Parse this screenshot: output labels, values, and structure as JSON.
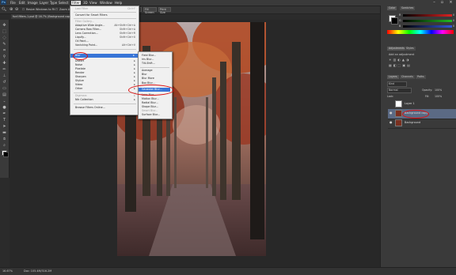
{
  "menubar": {
    "items": [
      "File",
      "Edit",
      "Image",
      "Layer",
      "Type",
      "Select",
      "Filter",
      "3D",
      "View",
      "Window",
      "Help"
    ],
    "window_controls": [
      "–",
      "▫",
      "×"
    ]
  },
  "options_bar": {
    "resize_windows": "Resize Windows to Fit",
    "zoom_all": "Zoom All Windows",
    "scrubby_zoom": "Scrubby Zoom",
    "actual_pixels": "Actual Pixels",
    "fit_screen": "Fit Screen",
    "fill_screen": "Fill Screen",
    "print_size": "Print Size"
  },
  "document_tab": "funf-filters-1.psd @ 16.7% (Background copy, RGB/8)",
  "filter_menu": {
    "items": [
      {
        "label": "Last Filter",
        "shortcut": "Ctrl+F",
        "disabled": true
      },
      {
        "sep": true
      },
      {
        "label": "Convert for Smart Filters"
      },
      {
        "sep": true
      },
      {
        "label": "Filter Gallery...",
        "disabled": true
      },
      {
        "label": "Adaptive Wide Angle...",
        "shortcut": "Alt+Shift+Ctrl+A"
      },
      {
        "label": "Camera Raw Filter...",
        "shortcut": "Shift+Ctrl+A"
      },
      {
        "label": "Lens Correction...",
        "shortcut": "Shift+Ctrl+R"
      },
      {
        "label": "Liquify...",
        "shortcut": "Shift+Ctrl+X"
      },
      {
        "label": "Oil Paint..."
      },
      {
        "label": "Vanishing Point...",
        "shortcut": "Alt+Ctrl+V"
      },
      {
        "sep": true
      },
      {
        "label": "Blur",
        "submenu": true,
        "highlighted": true
      },
      {
        "label": "Distort",
        "submenu": true
      },
      {
        "label": "Noise",
        "submenu": true
      },
      {
        "label": "Pixelate",
        "submenu": true
      },
      {
        "label": "Render",
        "submenu": true
      },
      {
        "label": "Sharpen",
        "submenu": true
      },
      {
        "label": "Stylize",
        "submenu": true
      },
      {
        "label": "Video",
        "submenu": true
      },
      {
        "label": "Other",
        "submenu": true
      },
      {
        "sep": true
      },
      {
        "label": "Digimarc",
        "submenu": true,
        "disabled": true
      },
      {
        "label": "Nik Collection",
        "submenu": true
      },
      {
        "sep": true
      },
      {
        "label": "Browse Filters Online..."
      }
    ]
  },
  "blur_submenu": {
    "items": [
      {
        "label": "Field Blur..."
      },
      {
        "label": "Iris Blur..."
      },
      {
        "label": "Tilt-Shift..."
      },
      {
        "sep": true
      },
      {
        "label": "Average"
      },
      {
        "label": "Blur"
      },
      {
        "label": "Blur More"
      },
      {
        "label": "Box Blur..."
      },
      {
        "label": "Gaussian Blur...",
        "highlighted": true
      },
      {
        "label": "Lens Blur..."
      },
      {
        "label": "Motion Blur..."
      },
      {
        "label": "Radial Blur..."
      },
      {
        "label": "Shape Blur..."
      },
      {
        "label": "Smart Blur...",
        "disabled": true
      },
      {
        "label": "Surface Blur..."
      }
    ]
  },
  "right_panel": {
    "color_tabs": [
      "Color",
      "Swatches"
    ],
    "color_sliders": [
      {
        "label": "R",
        "value": "0",
        "color": "#cc3333"
      },
      {
        "label": "G",
        "value": "0",
        "color": "#33aa33"
      },
      {
        "label": "B",
        "value": "0",
        "color": "#3355cc"
      }
    ],
    "adjust_tabs": [
      "Adjustments",
      "Styles"
    ],
    "adjust_title": "Add an adjustment",
    "layer_tabs": [
      "Layers",
      "Channels",
      "Paths"
    ],
    "kind_label": "Kind",
    "blend_mode": "Normal",
    "opacity_label": "Opacity:",
    "opacity_value": "100%",
    "lock_label": "Lock:",
    "fill_label": "Fill:",
    "fill_value": "100%",
    "layers": [
      {
        "name": "Layer 1",
        "selected": false,
        "thumb": "#ffffff"
      },
      {
        "name": "Background copy",
        "selected": true,
        "thumb": "#7a3020"
      },
      {
        "name": "Background",
        "selected": false,
        "thumb": "#7a3020"
      }
    ]
  },
  "status": {
    "zoom": "16.67%",
    "doc": "Doc: 105.4M/316.2M"
  },
  "colors": {
    "accent_highlight": "#3875d7",
    "annotation_circle": "#dd1111"
  }
}
